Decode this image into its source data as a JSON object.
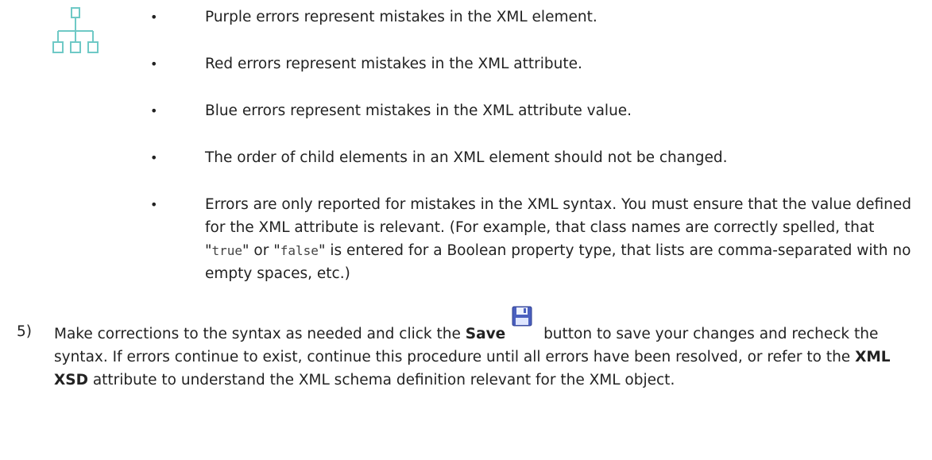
{
  "icons": {
    "hierarchy": "hierarchy-tree-icon",
    "save": "floppy-disk-save-icon"
  },
  "colors": {
    "hierarchy_icon": "#6fc9c6",
    "save_icon": "#4a5fbf",
    "text": "#222222"
  },
  "bullets": [
    "Purple errors represent mistakes in the XML element.",
    "Red errors represent mistakes in the XML attribute.",
    "Blue errors represent mistakes in the XML attribute value.",
    "The order of child elements in an XML element should not be changed."
  ],
  "bullet5": {
    "part1": "Errors are only reported for mistakes in the XML syntax. You must ensure that the value defined for the XML attribute is relevant. (For example, that class names are correctly spelled, that \"",
    "code_true": "true",
    "part2": "\" or \"",
    "code_false": "false",
    "part3": "\" is entered for a Boolean property type, that lists are comma-separated with no empty spaces, etc.)"
  },
  "step5": {
    "number": "5)",
    "part1": "Make corrections to the syntax as needed and click the ",
    "save_bold": "Save",
    "part2": " button to save your changes and recheck the syntax. If errors continue to exist, continue this procedure until all errors have been resolved, or refer to the ",
    "xsd_bold": "XML XSD",
    "part3": " attribute to understand the XML schema definition relevant for the XML object."
  }
}
